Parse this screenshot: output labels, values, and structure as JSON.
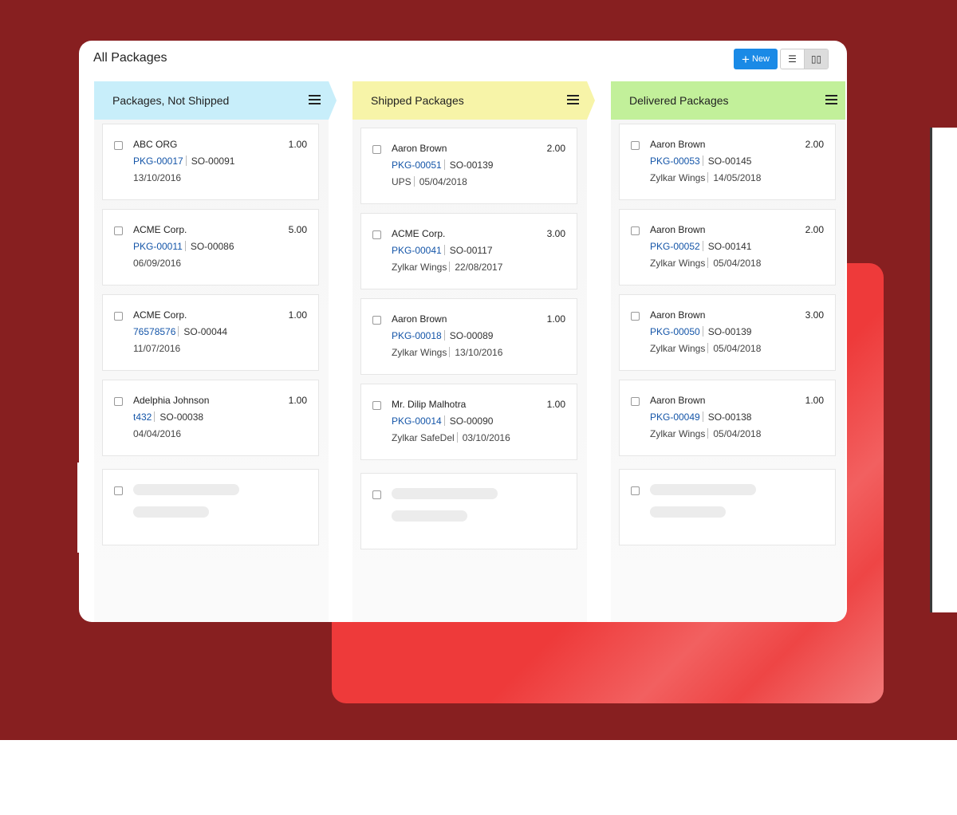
{
  "title": "All Packages",
  "toolbar": {
    "new_label": "New",
    "list_view_icon": "list-icon",
    "kanban_view_icon": "columns-icon"
  },
  "colors": {
    "not_shipped": "#c8eefa",
    "shipped": "#f7f4a8",
    "delivered": "#c2f09a",
    "accent": "#1a8ae6",
    "link": "#1455a8"
  },
  "columns": [
    {
      "title": "Packages, Not Shipped",
      "cards": [
        {
          "name": "ABC ORG",
          "qty": "1.00",
          "pkg": "PKG-00017",
          "so": "SO-00091",
          "carrier": "",
          "date": "13/10/2016"
        },
        {
          "name": "ACME Corp.",
          "qty": "5.00",
          "pkg": "PKG-00011",
          "so": "SO-00086",
          "carrier": "",
          "date": "06/09/2016"
        },
        {
          "name": "ACME Corp.",
          "qty": "1.00",
          "pkg": "76578576",
          "so": "SO-00044",
          "carrier": "",
          "date": "11/07/2016"
        },
        {
          "name": "Adelphia Johnson",
          "qty": "1.00",
          "pkg": "t432",
          "so": "SO-00038",
          "carrier": "",
          "date": "04/04/2016"
        }
      ]
    },
    {
      "title": "Shipped Packages",
      "cards": [
        {
          "name": "Aaron Brown",
          "qty": "2.00",
          "pkg": "PKG-00051",
          "so": "SO-00139",
          "carrier": "UPS",
          "date": "05/04/2018"
        },
        {
          "name": "ACME Corp.",
          "qty": "3.00",
          "pkg": "PKG-00041",
          "so": "SO-00117",
          "carrier": "Zylkar Wings",
          "date": "22/08/2017"
        },
        {
          "name": "Aaron Brown",
          "qty": "1.00",
          "pkg": "PKG-00018",
          "so": "SO-00089",
          "carrier": "Zylkar Wings",
          "date": "13/10/2016"
        },
        {
          "name": "Mr. Dilip Malhotra",
          "qty": "1.00",
          "pkg": "PKG-00014",
          "so": "SO-00090",
          "carrier": "Zylkar SafeDel",
          "date": "03/10/2016"
        }
      ]
    },
    {
      "title": "Delivered Packages",
      "cards": [
        {
          "name": "Aaron Brown",
          "qty": "2.00",
          "pkg": "PKG-00053",
          "so": "SO-00145",
          "carrier": "Zylkar Wings",
          "date": "14/05/2018"
        },
        {
          "name": "Aaron Brown",
          "qty": "2.00",
          "pkg": "PKG-00052",
          "so": "SO-00141",
          "carrier": "Zylkar Wings",
          "date": "05/04/2018"
        },
        {
          "name": "Aaron Brown",
          "qty": "3.00",
          "pkg": "PKG-00050",
          "so": "SO-00139",
          "carrier": "Zylkar Wings",
          "date": "05/04/2018"
        },
        {
          "name": "Aaron Brown",
          "qty": "1.00",
          "pkg": "PKG-00049",
          "so": "SO-00138",
          "carrier": "Zylkar Wings",
          "date": "05/04/2018"
        }
      ]
    }
  ]
}
